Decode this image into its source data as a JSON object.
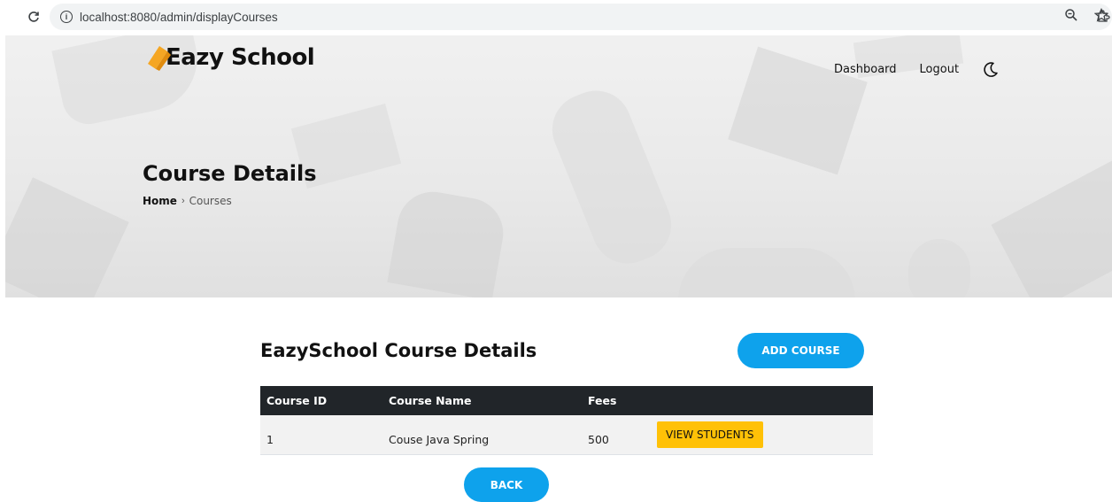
{
  "browser": {
    "url": "localhost:8080/admin/displayCourses"
  },
  "header": {
    "brand": "Eazy School",
    "nav": [
      {
        "label": "Dashboard"
      },
      {
        "label": "Logout"
      }
    ]
  },
  "hero": {
    "title": "Course Details",
    "breadcrumb": {
      "home": "Home",
      "separator": "›",
      "current": "Courses"
    }
  },
  "main": {
    "title": "EazySchool Course Details",
    "add_button": "ADD COURSE",
    "back_button": "BACK",
    "table": {
      "headers": [
        "Course ID",
        "Course Name",
        "Fees",
        ""
      ],
      "rows": [
        {
          "id": "1",
          "name": "Couse Java Spring",
          "fees": "500",
          "action": "VIEW STUDENTS"
        }
      ]
    }
  },
  "colors": {
    "accent": "#0ea2ec",
    "warning": "#ffc107",
    "table_header": "#212529",
    "logo_cap": "#f5a623"
  },
  "icons": {
    "reload": "reload-icon",
    "info": "info-icon",
    "zoom": "zoom-icon",
    "bookmark": "star-icon",
    "extensions": "puzzle-icon",
    "theme": "moon-icon",
    "logo": "graduation-cap-icon"
  }
}
